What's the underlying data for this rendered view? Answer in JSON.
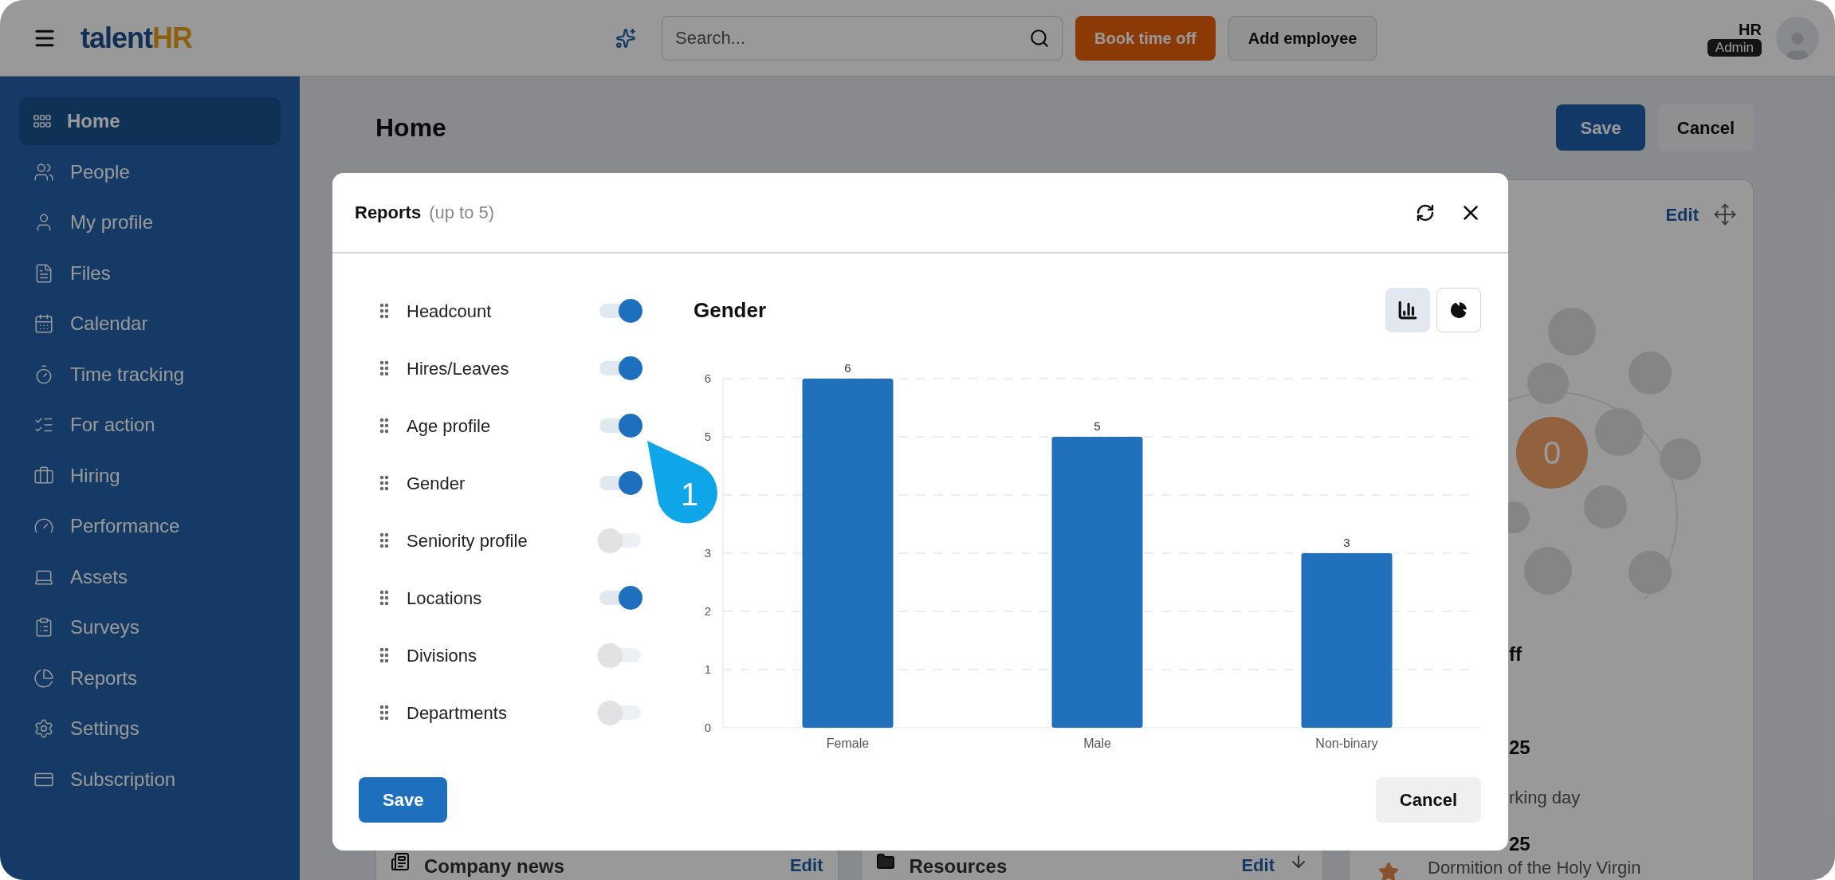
{
  "top_bar": {
    "logo": {
      "text": "talent",
      "accent": "HR"
    },
    "search": {
      "placeholder": "Search..."
    },
    "buttons": [
      "Book time off",
      "Add employee"
    ],
    "user": {
      "name": "HR",
      "role": "Admin"
    }
  },
  "sidebar": {
    "items": [
      {
        "label": "Home",
        "selected": true
      },
      {
        "label": "People",
        "selected": false
      },
      {
        "label": "My profile",
        "selected": false
      },
      {
        "label": "Files",
        "selected": false
      },
      {
        "label": "Calendar",
        "selected": false
      },
      {
        "label": "Time tracking",
        "selected": false
      },
      {
        "label": "For action",
        "selected": false
      },
      {
        "label": "Hiring",
        "selected": false
      },
      {
        "label": "Performance",
        "selected": false
      },
      {
        "label": "Assets",
        "selected": false
      },
      {
        "label": "Surveys",
        "selected": false
      },
      {
        "label": "Reports",
        "selected": false
      },
      {
        "label": "Settings",
        "selected": false
      },
      {
        "label": "Subscription",
        "selected": false
      }
    ]
  },
  "page": {
    "title": "Home",
    "buttons": [
      "Save",
      "Cancel"
    ],
    "widgets": [
      {
        "title": "Company news",
        "action": "Edit"
      },
      {
        "title": "Resources",
        "action": "Edit"
      }
    ],
    "side_card": {
      "action": "Edit",
      "counter": "0",
      "heading": "ff",
      "entries": [
        {
          "date": "25",
          "note": "rking day",
          "star": false
        },
        {
          "date": "25",
          "note": "Dormition of the Holy Virgin",
          "star": true
        }
      ]
    }
  },
  "modal": {
    "title": "Reports",
    "subtitle": "(up to 5)",
    "reports": [
      {
        "label": "Headcount",
        "on": true
      },
      {
        "label": "Hires/Leaves",
        "on": true
      },
      {
        "label": "Age profile",
        "on": true
      },
      {
        "label": "Gender",
        "on": true
      },
      {
        "label": "Seniority profile",
        "on": false
      },
      {
        "label": "Locations",
        "on": true
      },
      {
        "label": "Divisions",
        "on": false
      },
      {
        "label": "Departments",
        "on": false
      }
    ],
    "chart_views": [
      {
        "kind": "bar",
        "selected": true
      },
      {
        "kind": "pie",
        "selected": false
      }
    ],
    "chart": {
      "title": "Gender",
      "chart_data": {
        "type": "bar",
        "categories": [
          "Female",
          "Male",
          "Non-binary"
        ],
        "values": [
          6,
          5,
          3
        ],
        "ylim": [
          0,
          6
        ],
        "yticks": [
          0,
          1,
          2,
          3,
          5,
          6
        ],
        "grid": true,
        "data_labels": true
      }
    },
    "buttons": [
      "Save",
      "Cancel"
    ]
  },
  "callout": {
    "label": "1"
  }
}
